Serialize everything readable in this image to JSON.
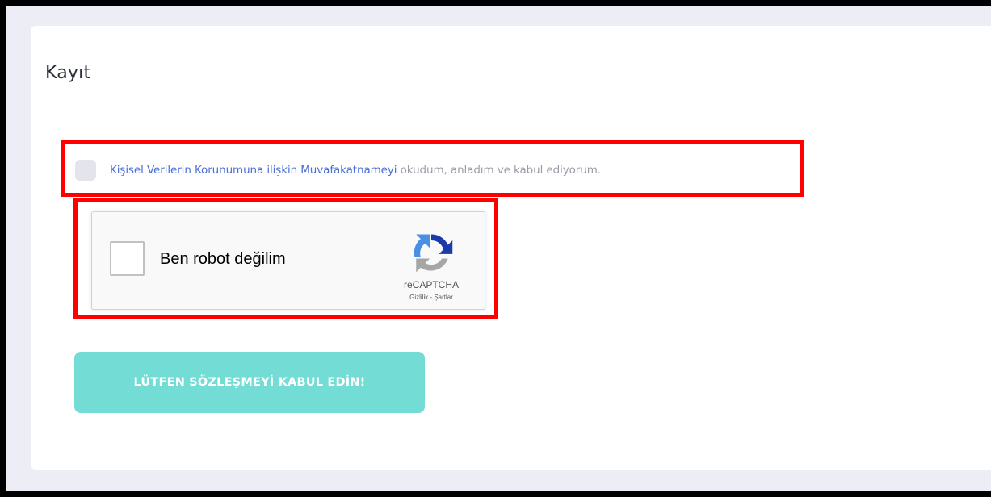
{
  "form": {
    "title": "Kayıt",
    "consent": {
      "checked": false,
      "link_text": "Kişisel Verilerin Korunumuna ilişkin Muvafakatnameyi",
      "rest_text": " okudum, anladım ve kabul ediyorum."
    },
    "captcha": {
      "checked": false,
      "label": "Ben robot değilim",
      "brand": "reCAPTCHA",
      "privacy_link": "Gizlilik",
      "separator": " - ",
      "terms_link": "Şartlar"
    },
    "submit_label": "LÜTFEN SÖZLEŞMEYİ KABUL EDİN!"
  },
  "colors": {
    "background": "#ecedf5",
    "card": "#ffffff",
    "link": "#4a6fd8",
    "muted_text": "#9a9ca8",
    "button": "#73dcd5",
    "highlight": "#ff0000"
  },
  "icons": {
    "captcha_logo": "recaptcha-logo-icon"
  }
}
